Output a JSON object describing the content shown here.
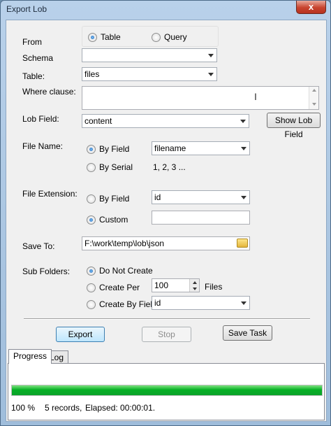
{
  "window": {
    "title": "Export Lob",
    "close": "x"
  },
  "from": {
    "label": "From",
    "options": [
      "Table",
      "Query"
    ],
    "selected": "Table"
  },
  "schema": {
    "label": "Schema",
    "value": ""
  },
  "table": {
    "label": "Table:",
    "value": "files"
  },
  "where": {
    "label": "Where clause:",
    "value": ""
  },
  "lob_field": {
    "label": "Lob Field:",
    "value": "content",
    "button": "Show Lob Field"
  },
  "file_name": {
    "label": "File Name:",
    "by_field": "By Field",
    "by_field_value": "filename",
    "by_serial": "By Serial",
    "serial_text": "1, 2, 3 ...",
    "selected": "By Field"
  },
  "file_ext": {
    "label": "File Extension:",
    "by_field": "By Field",
    "by_field_value": "id",
    "custom": "Custom",
    "custom_value": "",
    "selected": "Custom"
  },
  "save_to": {
    "label": "Save To:",
    "value": "F:\\work\\temp\\lob\\json"
  },
  "sub_folders": {
    "label": "Sub Folders:",
    "do_not_create": "Do Not Create",
    "create_per": "Create Per",
    "create_per_value": "100",
    "files_unit": "Files",
    "create_by_field": "Create By Field",
    "create_by_field_value": "id",
    "selected": "Do Not Create"
  },
  "buttons": {
    "export": "Export",
    "stop": "Stop",
    "save_task": "Save Task"
  },
  "tabs": [
    {
      "label": "Progress",
      "active": true
    },
    {
      "label": "Log",
      "active": false
    }
  ],
  "progress": {
    "fraction": 1.0,
    "percent_text": "100 %",
    "records_text": "5 records,",
    "elapsed_text": "Elapsed: 00:00:01."
  },
  "colors": {
    "progress_green": "#06b025",
    "accent_blue": "#1a5fb4"
  }
}
